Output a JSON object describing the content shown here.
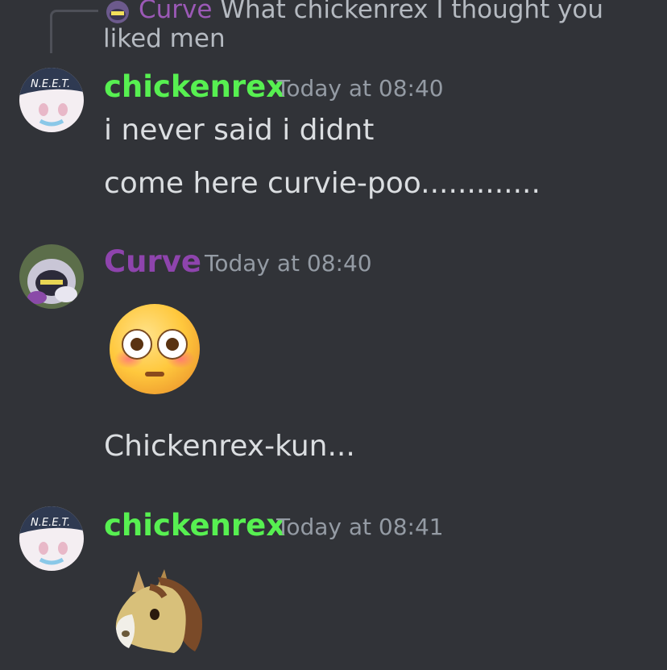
{
  "colors": {
    "background": "#313338",
    "chickenrex": "#57f051",
    "curve": "#8e44ad",
    "muted": "#949ba4"
  },
  "reply": {
    "author": "Curve",
    "text": "What chickenrex I thought you liked men"
  },
  "messages": [
    {
      "author": "chickenrex",
      "time": "Today at 08:40",
      "avatar_text": "N.E.E.T.",
      "lines": [
        "i never said i didnt",
        "come here curvie-poo............."
      ]
    },
    {
      "author": "Curve",
      "time": "Today at 08:40",
      "emoji": "flushed-face-emoji",
      "lines": [
        "Chickenrex-kun..."
      ]
    },
    {
      "author": "chickenrex",
      "time": "Today at 08:41",
      "avatar_text": "N.E.E.T.",
      "emoji": "horse-face-emoji"
    }
  ]
}
